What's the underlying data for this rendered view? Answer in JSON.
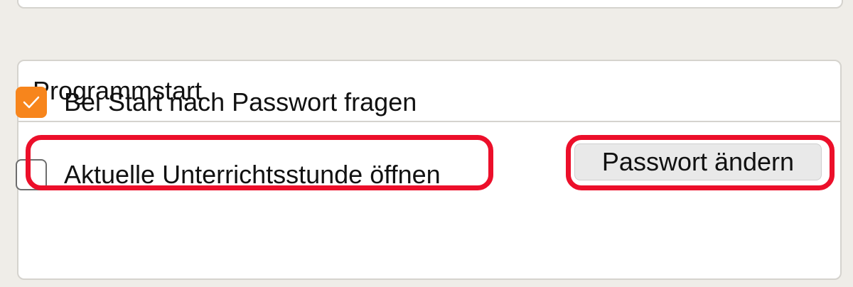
{
  "group": {
    "title": "Programmstart"
  },
  "options": {
    "ask_password": {
      "label": "Bei Start nach Passwort fragen",
      "checked": true
    },
    "open_current_lesson": {
      "label": "Aktuelle Unterrichtsstunde öffnen",
      "checked": false
    }
  },
  "buttons": {
    "change_password": "Passwort ändern"
  },
  "colors": {
    "background": "#efede8",
    "panel": "#ffffff",
    "border": "#d5d3ce",
    "checkbox_checked": "#f7851c",
    "highlight": "#ec0f2a",
    "button": "#e9e9e9"
  }
}
